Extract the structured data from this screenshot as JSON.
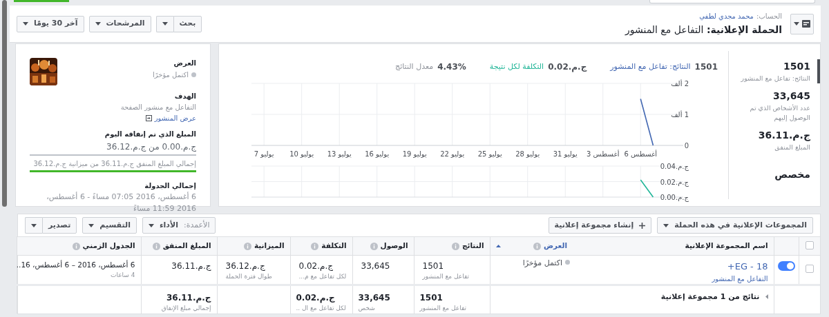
{
  "header": {
    "account_label": "الحساب:",
    "account_name": "محمد مجدي لطفي",
    "title": "**الحملة الإعلانية:** التفاعل مع المنشور",
    "buttons": [
      {
        "label": "بحث",
        "kind": "split"
      },
      {
        "label": "المرشحات",
        "kind": "dropdown"
      },
      {
        "label": "آخر 30 يومًا",
        "kind": "dropdown"
      }
    ]
  },
  "summary_panel": {
    "delivery": {
      "label": "العرض",
      "status": "اكتمل مؤخرًا"
    },
    "objective": {
      "label": "الهدف",
      "value": "التفاعل مع منشور الصفحة",
      "link": "عرض المنشور"
    },
    "spent_today": {
      "label": "المبلغ الذي تم إنفاقه اليوم",
      "value": "ج.م.0.00 من ج.م.36.12",
      "level": 0
    },
    "total_spent": {
      "value": "إجمالي المبلغ المنفق ج.م.36.11 من ميزانية ج.م.36.12",
      "level": 1
    },
    "schedule": {
      "label": "إجمالي الجدولة",
      "value": "6 أغسطس، 2016 07:05 مساءً - 6 أغسطس، 2016 11:59 مساءً"
    }
  },
  "chart_header": [
    {
      "value": "1501"
    },
    {
      "value": "ج.م.0.02",
      "label": "التكلفة لكل نتيجة",
      "color": "#1fb597"
    },
    {
      "value": "4.43%",
      "label": "معدل النتائج"
    }
  ],
  "charts": [
    {
      "chart_data": {
        "type": "line",
        "categories": [
          "يوليو 7",
          null,
          null,
          "يوليو 10",
          null,
          null,
          "يوليو 13",
          null,
          null,
          "يوليو 16",
          null,
          null,
          "يوليو 19",
          null,
          null,
          "يوليو 22",
          null,
          null,
          "يوليو 25",
          null,
          null,
          "يوليو 28",
          null,
          null,
          "يوليو 31",
          null,
          null,
          "أغسطس 3",
          null,
          null,
          "أغسطس 6",
          null
        ],
        "series": [
          {
            "name": "النتائج: تفاعل مع المنشور",
            "color": "#4267b2",
            "values": [
              null,
              null,
              null,
              null,
              null,
              null,
              null,
              null,
              null,
              null,
              null,
              null,
              null,
              null,
              null,
              null,
              null,
              null,
              null,
              null,
              null,
              null,
              null,
              null,
              null,
              null,
              null,
              null,
              null,
              null,
              1.5,
              0
            ]
          }
        ],
        "ylim": [
          0,
          2
        ],
        "grid": true,
        "yticks": [
          {
            "value": 0,
            "label": "0"
          },
          {
            "value": 1,
            "label": "1 ألف"
          },
          {
            "value": 2,
            "label": "2 ألف"
          }
        ]
      }
    },
    {
      "kind": "sparkline",
      "axis_labels": [
        "ج.م.0.04",
        "ج.م.0.02",
        "ج.م.0.00"
      ]
    }
  ],
  "metrics": [
    {
      "value": "1501",
      "label": "النتائج: تفاعل مع المنشور",
      "selected": true
    },
    {
      "value": "33,645",
      "label": "عدد الأشخاص الذي تم الوصول إليهم",
      "selected": false
    },
    {
      "value": "ج.م.36.11",
      "label": "المبلغ المنفق",
      "selected": false
    },
    {
      "value": "مخصص",
      "selected": false
    }
  ],
  "table_toolbar": {
    "right_buttons": [
      {
        "label": "المجموعات الإعلانية في هذه الحملة",
        "kind": "dropdown"
      },
      {
        "label": "إنشاء مجموعة إعلانية",
        "kind": "create"
      }
    ],
    "left_buttons": [
      {
        "label": "الأعمدة:",
        "value": "الأداء",
        "kind": "columns"
      },
      {
        "label": "التقسيم",
        "kind": "dropdown"
      },
      {
        "label": "تصدير",
        "kind": "split"
      }
    ]
  },
  "table": {
    "header_checked": false,
    "columns": [
      {
        "label": "اسم المجموعة الإعلانية",
        "info": false,
        "sorted": false
      },
      {
        "label": "العرض",
        "info": true,
        "sorted": true
      },
      {
        "label": "النتائج",
        "info": true,
        "sorted": false
      },
      {
        "label": "الوصول",
        "info": true,
        "sorted": false
      },
      {
        "label": "التكلفة",
        "info": true,
        "sorted": false
      },
      {
        "label": "الميزانية",
        "info": true,
        "sorted": false
      },
      {
        "label": "المبلغ المنفق",
        "info": true,
        "sorted": false
      },
      {
        "label": "الجدول الزمني",
        "info": true,
        "sorted": false
      }
    ],
    "rows": [
      {
        "checked": false,
        "on": true,
        "cells": [
          {
            "kind": "link",
            "value": "EG - 18+",
            "sub": "التفاعل مع المنشور"
          },
          {
            "kind": "status",
            "value": "اكتمل مؤخرًا"
          },
          {
            "kind": "metric",
            "value": "1501",
            "sub": "تفاعل مع المنشور"
          },
          {
            "kind": "metric",
            "value": "33,645"
          },
          {
            "kind": "metric",
            "value": "ج.م.0.02",
            "sub": "لكل تفاعل مع م..."
          },
          {
            "kind": "metric",
            "value": "ج.م.36.12",
            "sub": "طوال فترة الحملة"
          },
          {
            "kind": "metric",
            "value": "ج.م.36.11"
          },
          {
            "kind": "metric",
            "value": "6 أغسطس، 2016 – 6 أغسطس، 16..",
            "sub": "4 ساعات"
          }
        ]
      }
    ],
    "summary": {
      "label": "نتائج من **1** مجموعة إعلانية",
      "results": {
        "value": "1501",
        "sub": "تفاعل مع المنشور"
      },
      "reach": {
        "value": "33,645",
        "sub": "شخص"
      },
      "cost": {
        "value": "ج.م.0.02",
        "sub": "لكل تفاعل مع ال .."
      },
      "spent": {
        "value": "ج.م.36.11",
        "sub": "إجمالي مبلغ الإنفاق"
      }
    }
  }
}
